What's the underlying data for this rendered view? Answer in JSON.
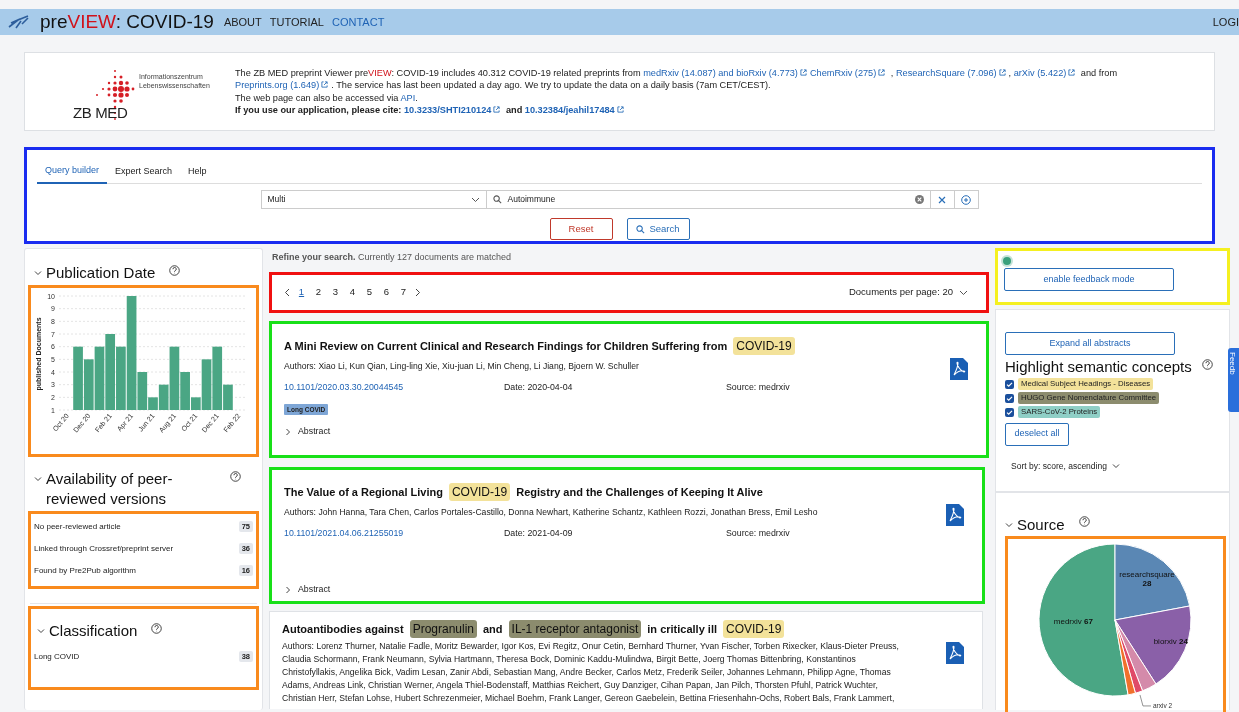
{
  "navbar": {
    "brand": [
      {
        "text": "pre",
        "kind": "plain"
      },
      {
        "text": "VIEW",
        "kind": "accent"
      },
      {
        "text": ": COVID-19",
        "kind": "plain"
      }
    ],
    "links": [
      {
        "label": "ABOUT",
        "selected": false
      },
      {
        "label": "TUTORIAL",
        "selected": false
      },
      {
        "label": "CONTACT",
        "selected": true
      }
    ],
    "login": "LOGI"
  },
  "info": {
    "logo": {
      "text": "ZB MED",
      "subtitle": [
        "Informationszentrum",
        "Lebenswissenschaften"
      ]
    },
    "paragraphs": [
      {
        "bold": false,
        "segments": [
          {
            "text": "The ZB MED preprint Viewer pre",
            "kind": "text"
          },
          {
            "text": "VIEW",
            "kind": "accent"
          },
          {
            "text": ": COVID-19 includes 40.312 COVID-19 related preprints from ",
            "kind": "text"
          },
          {
            "text": "medRxiv (14.087) and bioRxiv (4.773)",
            "kind": "external"
          },
          {
            "text": "ChemRxiv (275)",
            "kind": "external"
          },
          {
            "text": " , ",
            "kind": "text"
          },
          {
            "text": "ResearchSquare (7.096)",
            "kind": "external"
          },
          {
            "text": ", ",
            "kind": "text"
          },
          {
            "text": "arXiv (5.422)",
            "kind": "external"
          },
          {
            "text": " and from ",
            "kind": "text"
          },
          {
            "text": "Preprints.org (1.649)",
            "kind": "external"
          },
          {
            "text": ". The service has last been updated a day ago. We try to update the data on a daily basis (7am CET/CEST).",
            "kind": "text"
          }
        ]
      },
      {
        "bold": false,
        "segments": [
          {
            "text": "The web page can also be accessed via ",
            "kind": "text"
          },
          {
            "text": "API",
            "kind": "link"
          },
          {
            "text": ".",
            "kind": "text"
          }
        ]
      },
      {
        "bold": true,
        "segments": [
          {
            "text": "If you use our application, please cite: ",
            "kind": "text"
          },
          {
            "text": "10.3233/SHTI210124",
            "kind": "external"
          },
          {
            "text": " and ",
            "kind": "text"
          },
          {
            "text": "10.32384/jeahil17484",
            "kind": "external"
          }
        ]
      }
    ]
  },
  "query": {
    "tabs": [
      {
        "label": "Query builder",
        "selected": true
      },
      {
        "label": "Expert Search",
        "selected": false
      },
      {
        "label": "Help",
        "selected": false
      }
    ],
    "field_select": "Multi",
    "search_value": "Autoimmune",
    "reset": "Reset",
    "search": "Search"
  },
  "facets_left": [
    {
      "kind": "chart",
      "title": "Publication Date",
      "chart_data": {
        "type": "bar",
        "ylabel": "published Documents",
        "categories": [
          "Oct 20",
          null,
          "Dec 20",
          null,
          "Feb 21",
          null,
          "Apr 21",
          null,
          "Jun 21",
          null,
          "Aug 21",
          null,
          "Oct 21",
          null,
          "Dec 21",
          null,
          "Feb 22"
        ],
        "values": [
          null,
          6,
          5,
          6,
          7,
          6,
          10,
          4,
          2,
          3,
          6,
          4,
          2,
          5,
          6,
          3,
          null
        ],
        "ylim": [
          1,
          10
        ],
        "yticks": [
          1,
          2,
          3,
          4,
          5,
          6,
          7,
          8,
          9,
          10
        ],
        "grid": true
      }
    },
    {
      "kind": "list",
      "title": "Availability of peer-reviewed versions",
      "items": [
        {
          "label": "No peer-reviewed article",
          "count": "75"
        },
        {
          "label": "Linked through Crossref/preprint server",
          "count": "36"
        },
        {
          "label": "Found by Pre2Pub algorithm",
          "count": "16"
        }
      ]
    },
    {
      "kind": "list",
      "title": "Classification",
      "items": [
        {
          "label": "Long COVID",
          "count": "38"
        }
      ]
    }
  ],
  "results": {
    "summary": "**Refine your search.** Currently 127 documents are matched",
    "pages": [
      {
        "label": "1",
        "selected": true
      },
      {
        "label": "2",
        "selected": false
      },
      {
        "label": "3",
        "selected": false
      },
      {
        "label": "4",
        "selected": false
      },
      {
        "label": "5",
        "selected": false
      },
      {
        "label": "6",
        "selected": false
      },
      {
        "label": "7",
        "selected": false
      }
    ],
    "per_page": "Documents per page: 20",
    "papers": [
      {
        "title": [
          {
            "text": "A Mini Review on Current Clinical and Research Findings for Children Suffering from"
          },
          {
            "text": "COVID-19",
            "color": "#f3e29a"
          }
        ],
        "authors": "Authors: Xiao Li, Kun Qian, Ling-ling Xie, Xiu-juan Li, Min Cheng, Li Jiang, Bjoern W. Schuller",
        "doi": "10.1101/2020.03.30.20044545",
        "date": "Date: 2020-04-04",
        "source": "Source: medrxiv",
        "tags": [
          "Long COVID"
        ],
        "abstract": "Abstract",
        "expanded": false
      },
      {
        "title": [
          {
            "text": "The Value of a Regional Living"
          },
          {
            "text": "COVID-19",
            "color": "#f3e29a"
          },
          {
            "text": "Registry and the Challenges of Keeping It Alive"
          }
        ],
        "authors": "Authors: John Hanna, Tara Chen, Carlos Portales-Castillo, Donna Newhart, Katherine Schantz, Kathleen Rozzi, Jonathan Bress, Emil Lesho",
        "doi": "10.1101/2021.04.06.21255019",
        "date": "Date: 2021-04-09",
        "source": "Source: medrxiv",
        "abstract": "Abstract",
        "expanded": false
      },
      {
        "title": [
          {
            "text": "Autoantibodies against"
          },
          {
            "text": "Progranulin",
            "color": "#8c8c6e"
          },
          {
            "text": "and"
          },
          {
            "text": "IL-1 receptor antagonist",
            "color": "#8c8c6e"
          },
          {
            "text": "in critically ill"
          },
          {
            "text": "COVID-19",
            "color": "#f3e29a"
          }
        ],
        "authors": "Authors: Lorenz Thurner, Natalie Fadle, Moritz Bewarder, Igor Kos, Evi Regitz, Onur Cetin, Bernhard Thurner, Yvan Fischer, Torben Rixecker, Klaus-Dieter Preuss, Claudia Schormann, Frank Neumann, Sylvia Hartmann, Theresa Bock, Dominic Kaddu-Mulindwa, Birgit Bette, Joerg Thomas Bittenbring, Konstantinos Christofyllakis, Angelika Bick, Vadim Lesan, Zanir Abdi, Sebastian Mang, Andre Becker, Carlos Metz, Frederik Seiler, Johannes Lehmann, Philipp Agne, Thomas Adams, Andreas Link, Christian Werner, Angela Thiel-Bodenstaff, Matthias Reichert, Guy Danziger, Cihan Papan, Jan Pilch, Thorsten Pfuhl, Patrick Wuchter, Christian Herr, Stefan Lohse, Hubert Schrezenmeier, Michael Boehm, Frank Langer, Gereon Gaebelein, Bettina Friesenhahn-Ochs, Robert Bals, Frank Lammert,"
      }
    ]
  },
  "sidebar_right": {
    "feedback_button": "enable feedback mode",
    "expand_button": "Expand all abstracts",
    "concepts_title": "Highlight semantic concepts",
    "concepts": [
      {
        "label": "Medical Subject Headings - Diseases",
        "checked": true,
        "color": "#f3e29a"
      },
      {
        "label": "HUGO Gene Nomenclature Committee",
        "checked": true,
        "color": "#8c8c6e"
      },
      {
        "label": "SARS-CoV-2 Proteins",
        "checked": true,
        "color": "#8fcfc6"
      }
    ],
    "deselect_button": "deselect all",
    "sort": "Sort by: score, ascending",
    "source": {
      "title": "Source",
      "chart_data": {
        "type": "pie",
        "categories": [
          "researchsquare",
          "biorxiv",
          null,
          "arxiv",
          null,
          "medrxiv"
        ],
        "values": [
          28,
          24,
          4,
          2,
          2,
          67
        ],
        "value_labels": [
          "28",
          "24",
          null,
          "2",
          null,
          "67"
        ]
      }
    }
  },
  "feedback_tab": "Feedb"
}
